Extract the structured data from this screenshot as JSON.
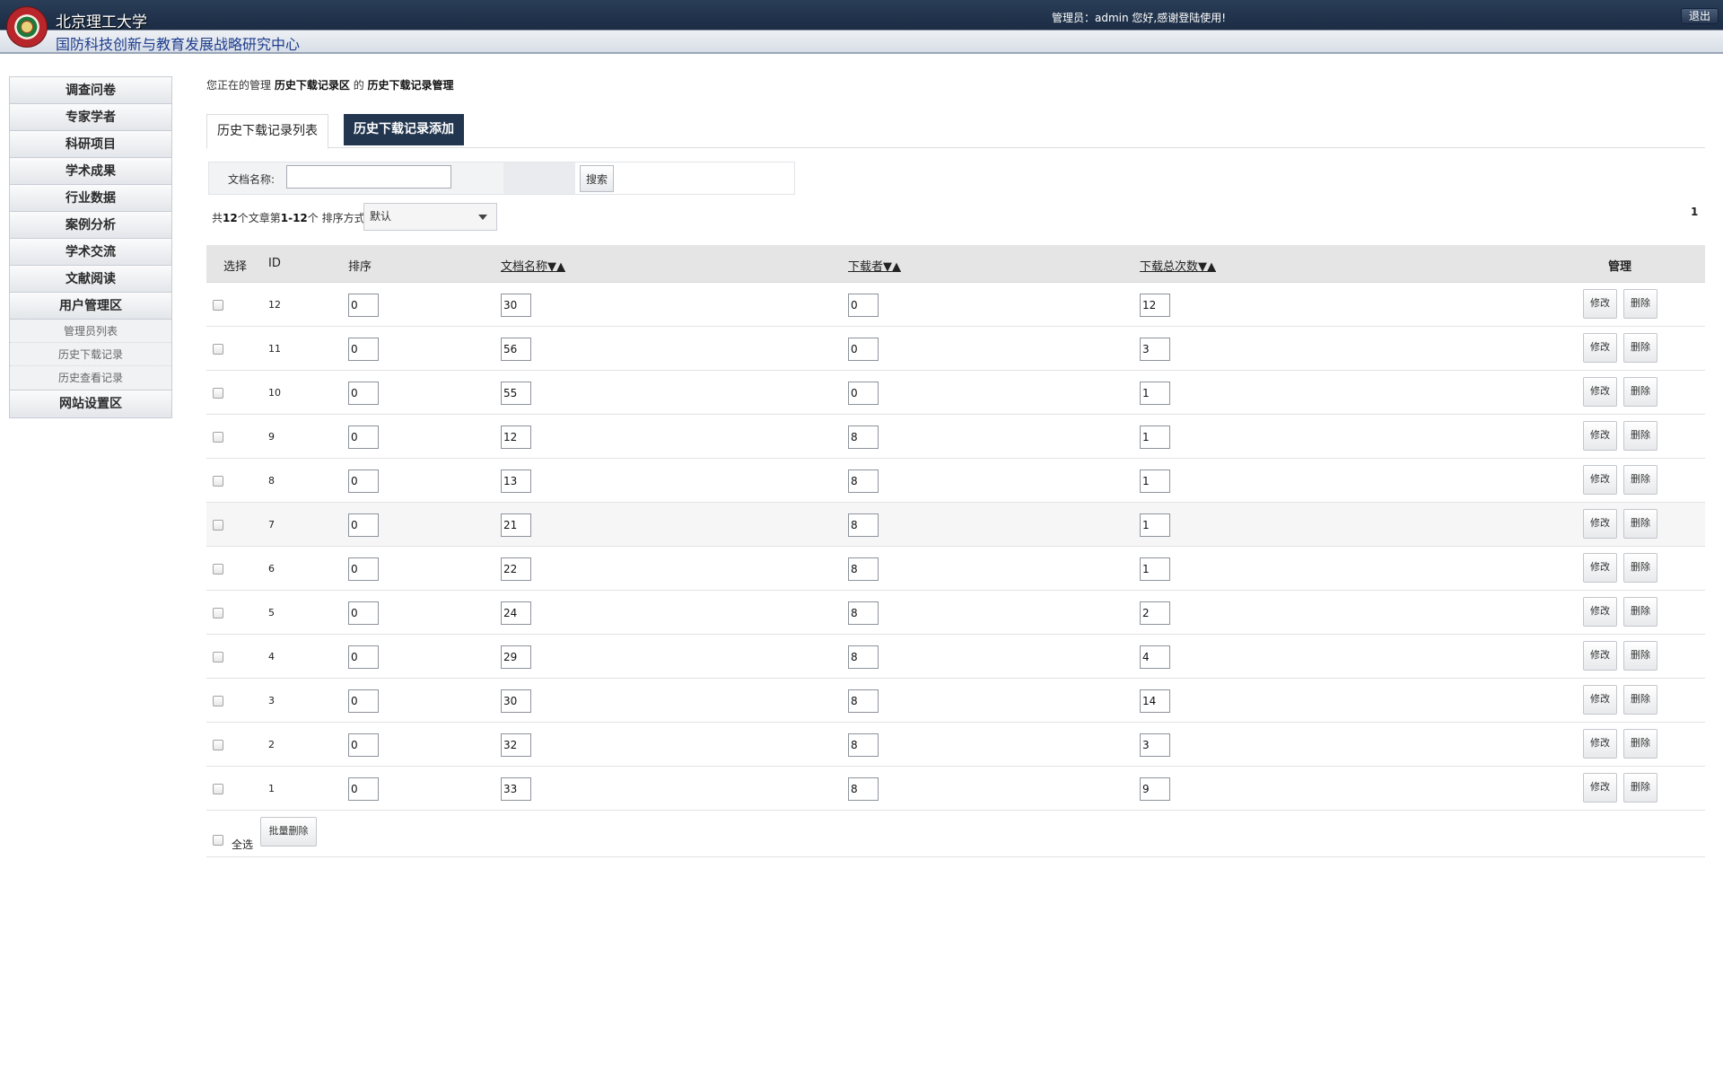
{
  "header": {
    "title": "北京理工大学",
    "subtitle": "国防科技创新与教育发展战略研究中心",
    "welcome": "管理员：admin 您好,感谢登陆使用!",
    "logout_label": "退出"
  },
  "sidebar": {
    "items": [
      {
        "label": "调查问卷"
      },
      {
        "label": "专家学者"
      },
      {
        "label": "科研项目"
      },
      {
        "label": "学术成果"
      },
      {
        "label": "行业数据"
      },
      {
        "label": "案例分析"
      },
      {
        "label": "学术交流"
      },
      {
        "label": "文献阅读"
      },
      {
        "label": "用户管理区"
      }
    ],
    "sub_items": [
      {
        "label": "管理员列表"
      },
      {
        "label": "历史下载记录"
      },
      {
        "label": "历史查看记录"
      }
    ],
    "last_item": {
      "label": "网站设置区"
    }
  },
  "breadcrumb": {
    "prefix": "您正在的管理",
    "section": "历史下载记录区",
    "connector": "的",
    "page": "历史下载记录管理"
  },
  "tabs": {
    "list_label": "历史下载记录列表",
    "add_label": "历史下载记录添加"
  },
  "search": {
    "label": "文档名称:",
    "value": "",
    "placeholder": "",
    "button_label": "搜索"
  },
  "summary": {
    "p1": "共",
    "total": "12",
    "p2": "个文章第",
    "range": "1-12",
    "p3": "个 排序方式:",
    "sort_value": "默认",
    "page": "1"
  },
  "table": {
    "headers": {
      "select": "选择",
      "id": "ID",
      "sort": "排序",
      "doc": "文档名称▼▲",
      "user": "下载者▼▲",
      "count": "下载总次数▼▲",
      "manage": "管理"
    },
    "edit_label": "修改",
    "delete_label": "删除",
    "rows": [
      {
        "id": "12",
        "sort": "0",
        "doc": "30",
        "user": "0",
        "count": "12"
      },
      {
        "id": "11",
        "sort": "0",
        "doc": "56",
        "user": "0",
        "count": "3"
      },
      {
        "id": "10",
        "sort": "0",
        "doc": "55",
        "user": "0",
        "count": "1"
      },
      {
        "id": "9",
        "sort": "0",
        "doc": "12",
        "user": "8",
        "count": "1"
      },
      {
        "id": "8",
        "sort": "0",
        "doc": "13",
        "user": "8",
        "count": "1"
      },
      {
        "id": "7",
        "sort": "0",
        "doc": "21",
        "user": "8",
        "count": "1"
      },
      {
        "id": "6",
        "sort": "0",
        "doc": "22",
        "user": "8",
        "count": "1"
      },
      {
        "id": "5",
        "sort": "0",
        "doc": "24",
        "user": "8",
        "count": "2"
      },
      {
        "id": "4",
        "sort": "0",
        "doc": "29",
        "user": "8",
        "count": "4"
      },
      {
        "id": "3",
        "sort": "0",
        "doc": "30",
        "user": "8",
        "count": "14"
      },
      {
        "id": "2",
        "sort": "0",
        "doc": "32",
        "user": "8",
        "count": "3"
      },
      {
        "id": "1",
        "sort": "0",
        "doc": "33",
        "user": "8",
        "count": "9"
      }
    ],
    "select_all_label": "全选",
    "batch_delete_label": "批量删除"
  }
}
